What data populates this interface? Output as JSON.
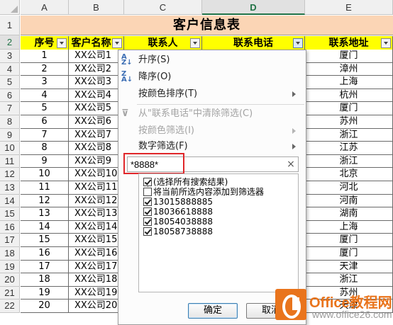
{
  "sheet": {
    "columns": [
      "A",
      "B",
      "C",
      "D",
      "E"
    ],
    "selected_column": "D",
    "rows": [
      "1",
      "2",
      "3",
      "4",
      "5",
      "6",
      "7",
      "8",
      "9",
      "10",
      "11",
      "12",
      "13",
      "14",
      "15",
      "16",
      "17",
      "18",
      "19",
      "20",
      "21",
      "22"
    ],
    "title": "客户信息表",
    "headers": [
      "序号",
      "客户名称",
      "联系人",
      "联系电话",
      "联系地址"
    ],
    "seq": [
      "1",
      "2",
      "3",
      "4",
      "5",
      "6",
      "7",
      "8",
      "9",
      "10",
      "11",
      "12",
      "13",
      "14",
      "15",
      "16",
      "17",
      "18",
      "19",
      "20"
    ],
    "company": [
      "XX公司1",
      "XX公司2",
      "XX公司3",
      "XX公司4",
      "XX公司5",
      "XX公司6",
      "XX公司7",
      "XX公司8",
      "XX公司9",
      "XX公司10",
      "XX公司11",
      "XX公司12",
      "XX公司13",
      "XX公司14",
      "XX公司15",
      "XX公司16",
      "XX公司17",
      "XX公司18",
      "XX公司19",
      "XX公司20"
    ],
    "address": [
      "厦门",
      "漳州",
      "上海",
      "杭州",
      "厦门",
      "苏州",
      "浙江",
      "江苏",
      "浙江",
      "北京",
      "河北",
      "河南",
      "湖南",
      "上海",
      "厦门",
      "厦门",
      "天津",
      "浙江",
      "苏州",
      "天津"
    ]
  },
  "menu": {
    "sort_asc": "升序(S)",
    "sort_desc": "降序(O)",
    "sort_by_color": "按颜色排序(T)",
    "clear_filter": "从\"联系电话\"中清除筛选(C)",
    "filter_by_color": "按颜色筛选(I)",
    "number_filter": "数字筛选(F)",
    "search_value": "*8888*",
    "clear_icon": "×",
    "list": [
      {
        "label": "(选择所有搜索结果)",
        "checked": true
      },
      {
        "label": "将当前所选内容添加到筛选器",
        "checked": false
      },
      {
        "label": "13015888885",
        "checked": true
      },
      {
        "label": "18036618888",
        "checked": true
      },
      {
        "label": "18054038888",
        "checked": true
      },
      {
        "label": "18058738888",
        "checked": true
      }
    ],
    "ok_label": "确定",
    "cancel_label": "取消"
  },
  "watermark": {
    "brand": "Office教程网",
    "url": "www.office26.com"
  },
  "colors": {
    "title_fill": "#fbd5b5",
    "header_fill": "#ffff00",
    "highlight": "#e0262a",
    "brand": "#e9741c"
  }
}
